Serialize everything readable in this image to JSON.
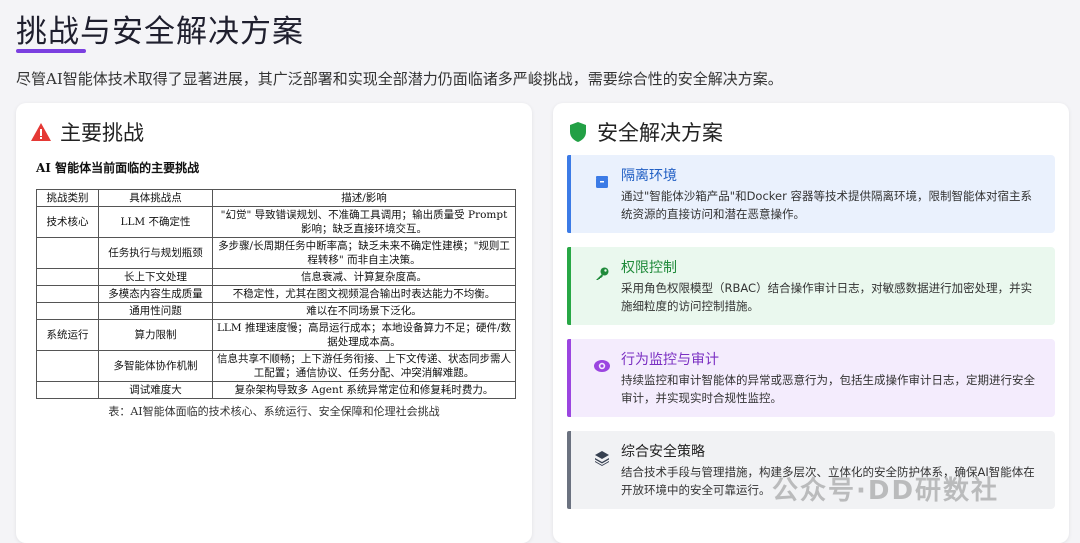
{
  "header": {
    "title": "挑战与安全解决方案",
    "intro": "尽管AI智能体技术取得了显著进展，其广泛部署和实现全部潜力仍面临诸多严峻挑战，需要综合性的安全解决方案。"
  },
  "left": {
    "heading": "主要挑战",
    "figure_title": "AI 智能体当前面临的主要挑战",
    "columns": [
      "挑战类别",
      "具体挑战点",
      "描述/影响"
    ],
    "rows": [
      {
        "cat": "技术核心",
        "point": "LLM 不确定性",
        "desc": "\"幻觉\" 导致错误规划、不准确工具调用；输出质量受 Prompt 影响；缺乏直接环境交互。"
      },
      {
        "cat": "",
        "point": "任务执行与规划瓶颈",
        "desc": "多步骤/长周期任务中断率高；缺乏未来不确定性建模；\"规则工程转移\" 而非自主决策。"
      },
      {
        "cat": "",
        "point": "长上下文处理",
        "desc": "信息衰减、计算复杂度高。"
      },
      {
        "cat": "",
        "point": "多模态内容生成质量",
        "desc": "不稳定性，尤其在图文视频混合输出时表达能力不均衡。"
      },
      {
        "cat": "",
        "point": "通用性问题",
        "desc": "难以在不同场景下泛化。"
      },
      {
        "cat": "系统运行",
        "point": "算力限制",
        "desc": "LLM 推理速度慢；高昂运行成本；本地设备算力不足；硬件/数据处理成本高。"
      },
      {
        "cat": "",
        "point": "多智能体协作机制",
        "desc": "信息共享不顺畅；上下游任务衔接、上下文传递、状态同步需人工配置；通信协议、任务分配、冲突消解难题。"
      },
      {
        "cat": "",
        "point": "调试难度大",
        "desc": "复杂架构导致多 Agent 系统异常定位和修复耗时费力。"
      }
    ],
    "caption": "表：AI智能体面临的技术核心、系统运行、安全保障和伦理社会挑战"
  },
  "right": {
    "heading": "安全解决方案",
    "solutions": [
      {
        "title": "隔离环境",
        "desc": "通过\"智能体沙箱产品\"和Docker 容器等技术提供隔离环境，限制智能体对宿主系统资源的直接访问和潜在恶意操作。",
        "icon": "box-icon",
        "color": "#3c7be6"
      },
      {
        "title": "权限控制",
        "desc": "采用角色权限模型（RBAC）结合操作审计日志，对敏感数据进行加密处理，并实施细粒度的访问控制措施。",
        "icon": "key-icon",
        "color": "#28a745"
      },
      {
        "title": "行为监控与审计",
        "desc": "持续监控和审计智能体的异常或恶意行为，包括生成操作审计日志，定期进行安全审计，并实现实时合规性监控。",
        "icon": "eye-icon",
        "color": "#9b45e0"
      },
      {
        "title": "综合安全策略",
        "desc": "结合技术手段与管理措施，构建多层次、立体化的安全防护体系，确保AI智能体在开放环境中的安全可靠运行。",
        "icon": "layers-icon",
        "color": "#4b5563"
      }
    ]
  },
  "watermark": "公众号·DD研数社"
}
